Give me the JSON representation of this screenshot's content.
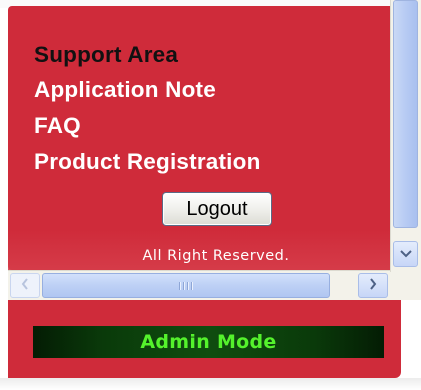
{
  "menu": {
    "support_area": "Support Area",
    "application_note": "Application Note",
    "faq": "FAQ",
    "product_registration": "Product Registration"
  },
  "logout_label": "Logout",
  "copyright": "All Right Reserved.",
  "status": {
    "mode": "Admin Mode"
  },
  "colors": {
    "panel_red": "#cf2b3a",
    "mode_text": "#54f22c",
    "mode_bg": "#0a3a0a"
  },
  "icons": {
    "scroll_down": "chevron-down-icon",
    "scroll_left": "chevron-left-icon",
    "scroll_right": "chevron-right-icon",
    "thumb_grip": "grip-icon"
  }
}
